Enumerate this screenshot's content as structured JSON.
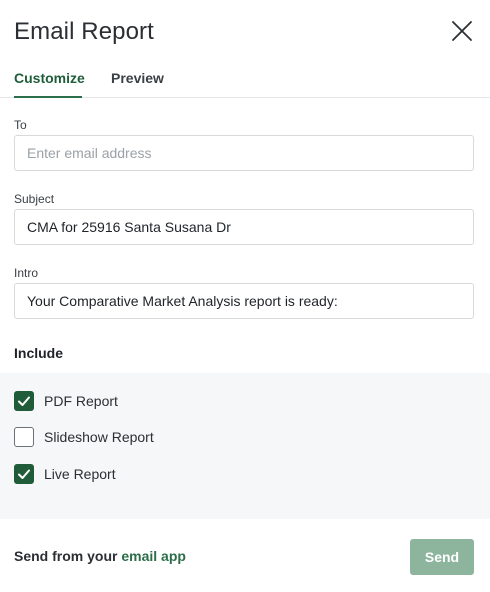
{
  "dialog": {
    "title": "Email Report",
    "close_icon": "close-icon"
  },
  "tabs": [
    {
      "label": "Customize",
      "active": true
    },
    {
      "label": "Preview",
      "active": false
    }
  ],
  "fields": {
    "to": {
      "label": "To",
      "value": "",
      "placeholder": "Enter email address"
    },
    "subject": {
      "label": "Subject",
      "value": "CMA for 25916 Santa Susana Dr"
    },
    "intro": {
      "label": "Intro",
      "value": "Your Comparative Market Analysis report is ready:"
    }
  },
  "include": {
    "heading": "Include",
    "options": [
      {
        "label": "PDF Report",
        "checked": true
      },
      {
        "label": "Slideshow Report",
        "checked": false
      },
      {
        "label": "Live Report",
        "checked": true
      }
    ]
  },
  "footer": {
    "prefix": "Send from your ",
    "link": "email app",
    "send_label": "Send"
  },
  "colors": {
    "accent": "#2c6e49",
    "checkbox_checked": "#215c3a",
    "send_disabled": "#8db59e"
  }
}
